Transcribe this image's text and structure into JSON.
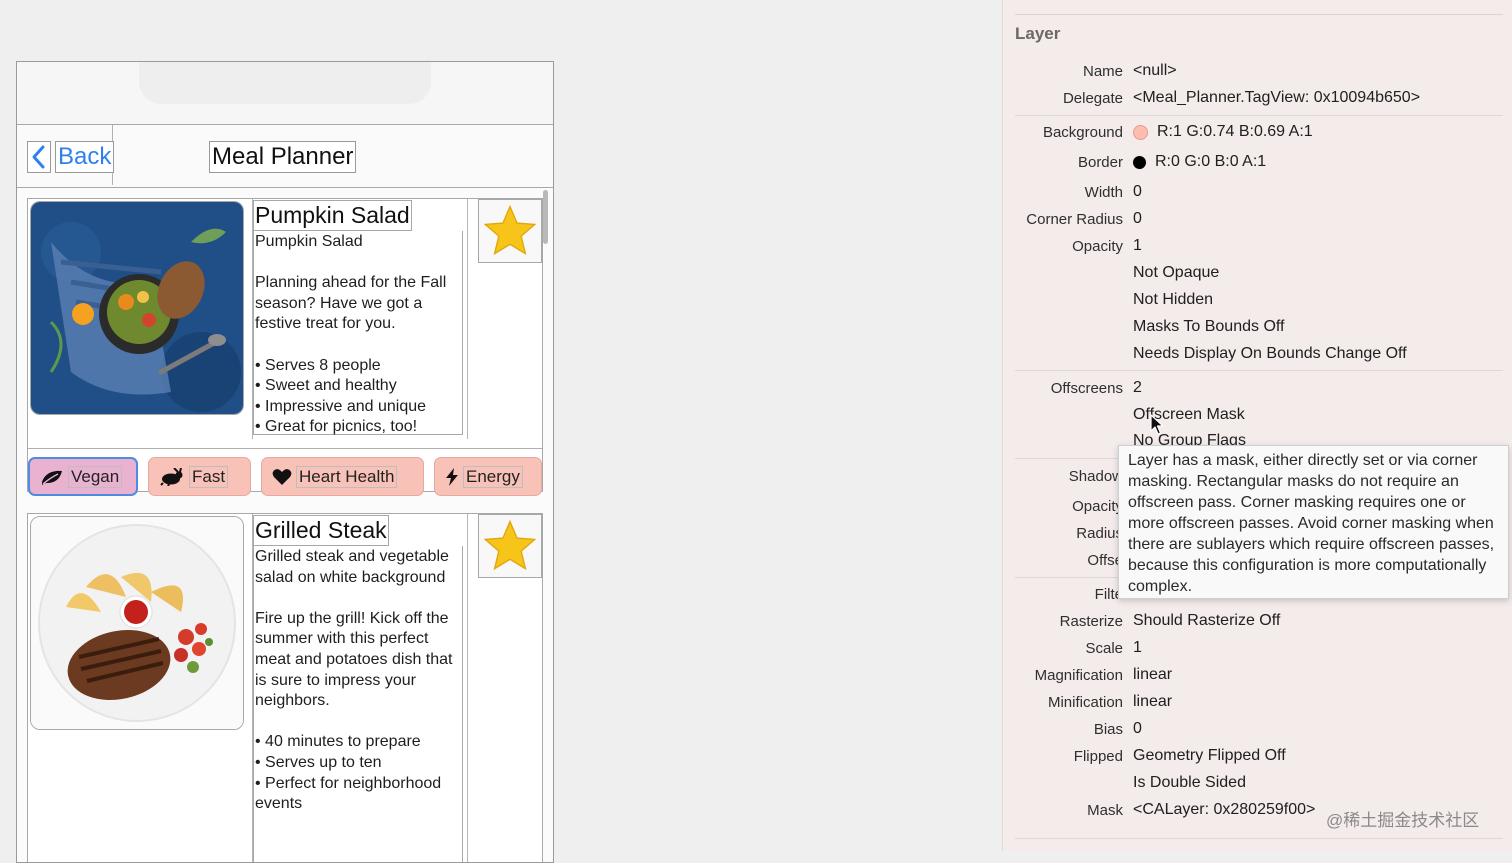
{
  "app": {
    "back_label": "Back",
    "title": "Meal Planner"
  },
  "meals": [
    {
      "title": "Pumpkin Salad",
      "description": "Pumpkin Salad\n\nPlanning ahead for the Fall season? Have we got a festive treat for you.\n\n• Serves 8 people\n• Sweet and healthy\n• Impressive and unique\n• Great for picnics, too!",
      "favorite_icon": "star-icon"
    },
    {
      "title": "Grilled Steak",
      "description": "Grilled steak and vegetable salad on white background\n\nFire up the grill! Kick off the summer with this perfect meat and potatoes dish that is sure to impress your neighbors.\n\n• 40 minutes to prepare\n• Serves up to ten\n• Perfect for neighborhood events",
      "favorite_icon": "star-icon"
    }
  ],
  "tags": [
    {
      "label": "Vegan",
      "icon": "leaf-icon",
      "selected": true
    },
    {
      "label": "Fast",
      "icon": "rabbit-icon",
      "selected": false
    },
    {
      "label": "Heart Health",
      "icon": "heart-icon",
      "selected": false
    },
    {
      "label": "Energy",
      "icon": "bolt-icon",
      "selected": false
    }
  ],
  "inspector": {
    "section": "Layer",
    "name_label": "Name",
    "name_value": "<null>",
    "delegate_label": "Delegate",
    "delegate_value": "<Meal_Planner.TagView: 0x10094b650>",
    "background_label": "Background",
    "background_value": "R:1 G:0.74 B:0.69 A:1",
    "background_color": "#ffbdb0",
    "border_label": "Border",
    "border_value": "R:0 G:0 B:0 A:1",
    "border_color": "#000000",
    "width_label": "Width",
    "width_value": "0",
    "corner_radius_label": "Corner Radius",
    "corner_radius_value": "0",
    "opacity_label": "Opacity",
    "opacity_value": "1",
    "flag_not_opaque": "Not Opaque",
    "flag_not_hidden": "Not Hidden",
    "flag_masks": "Masks To Bounds Off",
    "flag_needs_display": "Needs Display On Bounds Change Off",
    "offscreens_label": "Offscreens",
    "offscreens_value": "2",
    "offscreen_mask": "Offscreen Mask",
    "no_group_flags": "No Group Flags",
    "shadow_label": "Shadow",
    "shadow_opacity_label": "Opacity",
    "shadow_radius_label": "Radius",
    "shadow_offset_label": "Offse",
    "filter_label": "Filte",
    "rasterize_label": "Rasterize",
    "rasterize_value": "Should Rasterize Off",
    "scale_label": "Scale",
    "scale_value": "1",
    "magnification_label": "Magnification",
    "magnification_value": "linear",
    "minification_label": "Minification",
    "minification_value": "linear",
    "bias_label": "Bias",
    "bias_value": "0",
    "flipped_label": "Flipped",
    "flipped_value": "Geometry Flipped Off",
    "double_sided": "Is Double Sided",
    "mask_label": "Mask",
    "mask_value": "<CALayer: 0x280259f00>"
  },
  "tooltip": "Layer has a mask, either directly set or via corner masking. Rectangular masks do not require an offscreen pass. Corner masking requires one or more offscreen passes. Avoid corner masking when there are sublayers which require offscreen passes, because this configuration is more computationally complex.",
  "watermark": "@稀土掘金技术社区"
}
